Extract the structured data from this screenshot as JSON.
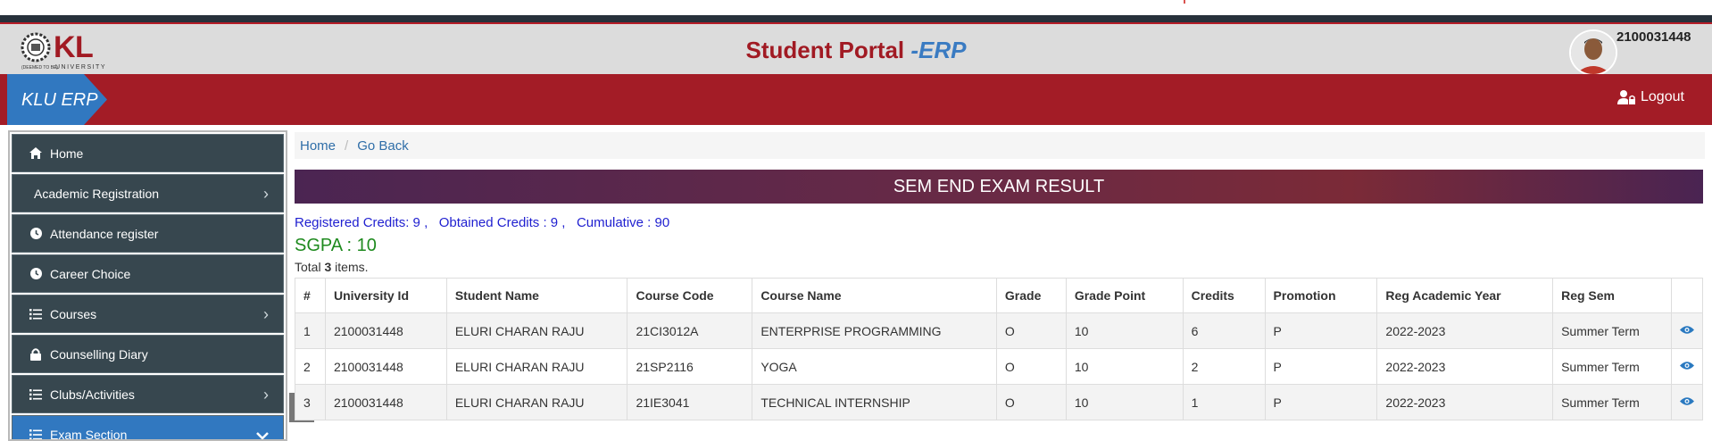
{
  "header": {
    "logo_main": "KL",
    "logo_sub": "UNIVERSITY",
    "logo_tag": "(DEEMED TO BE)",
    "title_main": "Student Portal ",
    "title_accent": "-ERP",
    "user_id": "2100031448"
  },
  "navbar": {
    "brand": "KLU ERP",
    "logout_label": "Logout"
  },
  "sidebar": {
    "items": [
      {
        "label": "Home",
        "icon": "home-icon"
      },
      {
        "label": "Academic Registration",
        "icon": "",
        "chevron": "right"
      },
      {
        "label": "Attendance register",
        "icon": "clock-icon"
      },
      {
        "label": "Career Choice",
        "icon": "clock-icon"
      },
      {
        "label": "Courses",
        "icon": "list-icon",
        "chevron": "right"
      },
      {
        "label": "Counselling Diary",
        "icon": "lock-icon"
      },
      {
        "label": "Clubs/Activities",
        "icon": "list-icon",
        "chevron": "right"
      },
      {
        "label": "Exam Section",
        "icon": "list-icon",
        "chevron": "down",
        "active": true
      }
    ]
  },
  "breadcrumb": {
    "home": "Home",
    "back": "Go Back"
  },
  "result": {
    "banner": "SEM END EXAM RESULT",
    "credits_line": "Registered Credits: 9 ,   Obtained Credits : 9 ,   Cumulative : 90",
    "sgpa": "SGPA : 10",
    "total_prefix": "Total ",
    "total_count": "3",
    "total_suffix": " items."
  },
  "table": {
    "headers": [
      "#",
      "University Id",
      "Student Name",
      "Course Code",
      "Course Name",
      "Grade",
      "Grade Point",
      "Credits",
      "Promotion",
      "Reg Academic Year",
      "Reg Sem",
      ""
    ],
    "rows": [
      [
        "1",
        "2100031448",
        "ELURI CHARAN RAJU",
        "21CI3012A",
        "ENTERPRISE PROGRAMMING",
        "O",
        "10",
        "6",
        "P",
        "2022-2023",
        "Summer Term"
      ],
      [
        "2",
        "2100031448",
        "ELURI CHARAN RAJU",
        "21SP2116",
        "YOGA",
        "O",
        "10",
        "2",
        "P",
        "2022-2023",
        "Summer Term"
      ],
      [
        "3",
        "2100031448",
        "ELURI CHARAN RAJU",
        "21IE3041",
        "TECHNICAL INTERNSHIP",
        "O",
        "10",
        "1",
        "P",
        "2022-2023",
        "Summer Term"
      ]
    ]
  },
  "colors": {
    "brand_red": "#a31c26",
    "sidebar_bg": "#37474f",
    "sidebar_active": "#3178c0",
    "link_blue": "#2f6ea8",
    "sgpa_green": "#1e8a1e"
  }
}
